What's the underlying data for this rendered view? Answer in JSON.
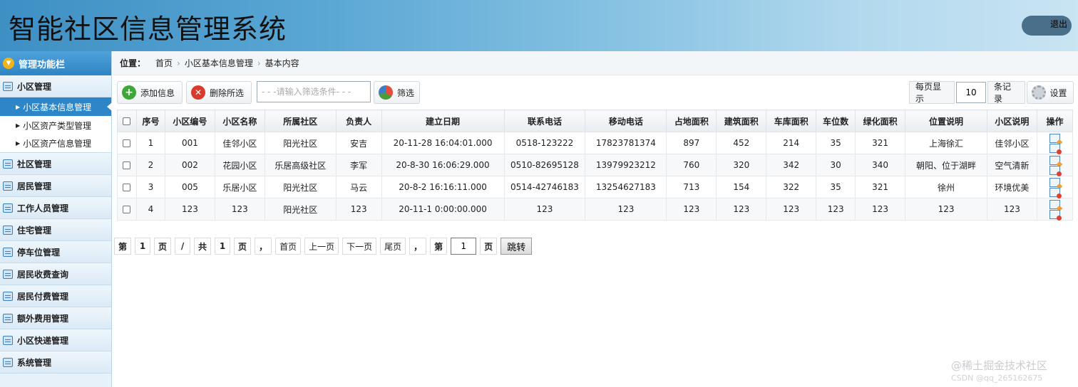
{
  "header": {
    "title": "智能社区信息管理系统",
    "logout_label": "退出"
  },
  "sidebar": {
    "heading": "管理功能栏",
    "groups": [
      {
        "label": "小区管理",
        "items": [
          "小区基本信息管理",
          "小区资产类型管理",
          "小区资产信息管理"
        ]
      },
      {
        "label": "社区管理"
      },
      {
        "label": "居民管理"
      },
      {
        "label": "工作人员管理"
      },
      {
        "label": "住宅管理"
      },
      {
        "label": "停车位管理"
      },
      {
        "label": "居民收费查询"
      },
      {
        "label": "居民付费管理"
      },
      {
        "label": "额外费用管理"
      },
      {
        "label": "小区快递管理"
      },
      {
        "label": "系统管理"
      }
    ]
  },
  "breadcrumb": {
    "label": "位置：",
    "items": [
      "首页",
      "小区基本信息管理",
      "基本内容"
    ],
    "sep": "›"
  },
  "toolbar": {
    "add_label": "添加信息",
    "delete_label": "删除所选",
    "filter_placeholder": "- - -请输入筛选条件- - -",
    "filter_label": "筛选",
    "per_page_label": "每页显示",
    "per_page_value": "10",
    "records_label": "条记录",
    "settings_label": "设置"
  },
  "table": {
    "headers": [
      "序号",
      "小区编号",
      "小区名称",
      "所属社区",
      "负责人",
      "建立日期",
      "联系电话",
      "移动电话",
      "占地面积",
      "建筑面积",
      "车库面积",
      "车位数",
      "绿化面积",
      "位置说明",
      "小区说明",
      "操作"
    ],
    "rows": [
      [
        "1",
        "001",
        "佳邻小区",
        "阳光社区",
        "安吉",
        "20-11-28 16:04:01.000",
        "0518-123222",
        "17823781374",
        "897",
        "452",
        "214",
        "35",
        "321",
        "上海徐汇",
        "佳邻小区"
      ],
      [
        "2",
        "002",
        "花园小区",
        "乐居高级社区",
        "李军",
        "20-8-30 16:06:29.000",
        "0510-82695128",
        "13979923212",
        "760",
        "320",
        "342",
        "30",
        "340",
        "朝阳、位于湖畔",
        "空气清新"
      ],
      [
        "3",
        "005",
        "乐居小区",
        "阳光社区",
        "马云",
        "20-8-2 16:16:11.000",
        "0514-42746183",
        "13254627183",
        "713",
        "154",
        "322",
        "35",
        "321",
        "徐州",
        "环境优美"
      ],
      [
        "4",
        "123",
        "123",
        "阳光社区",
        "123",
        "20-11-1 0:00:00.000",
        "123",
        "123",
        "123",
        "123",
        "123",
        "123",
        "123",
        "123",
        "123"
      ]
    ]
  },
  "pager": {
    "di": "第",
    "current": "1",
    "ye": "页",
    "slash": "/",
    "gong": "共",
    "total": "1",
    "ye2": "页",
    "comma": "，",
    "first": "首页",
    "prev": "上一页",
    "next": "下一页",
    "last": "尾页",
    "comma2": "，",
    "di2": "第",
    "jump_value": "1",
    "ye3": "页",
    "go_label": "跳转"
  },
  "watermark": {
    "line1": "@稀土掘金技术社区",
    "line2": "CSDN @qq_265162675"
  }
}
